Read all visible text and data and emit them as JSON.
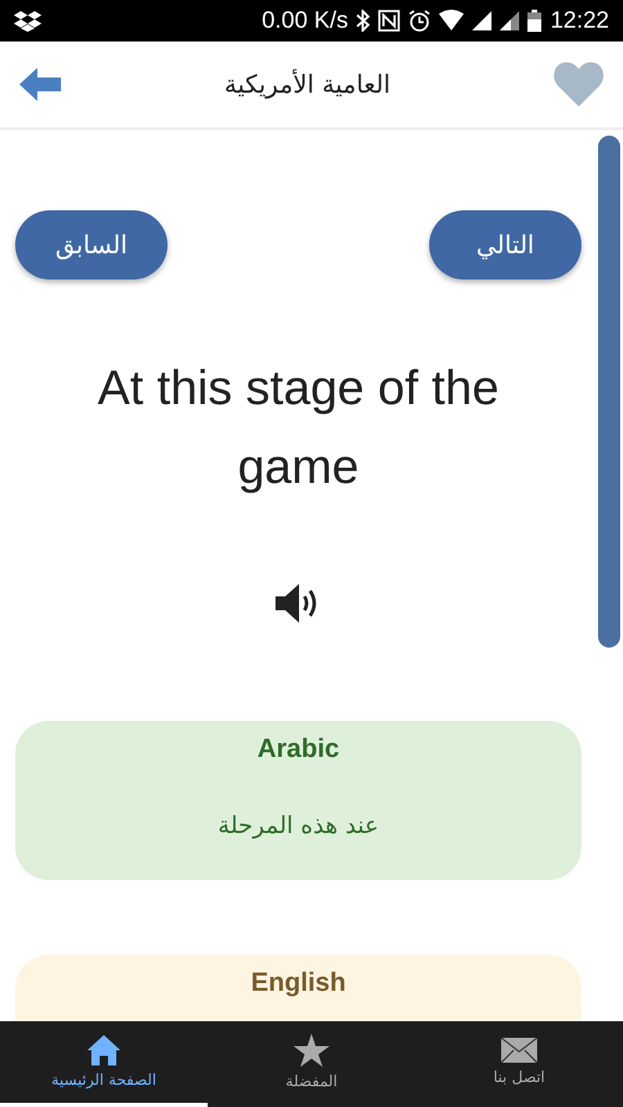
{
  "status_bar": {
    "speed": "0.00 K/s",
    "time": "12:22"
  },
  "header": {
    "title": "العامية الأمريكية",
    "favorite": false
  },
  "nav_buttons": [
    {
      "kind": "next",
      "label": "التالي"
    },
    {
      "kind": "previous",
      "label": "السابق"
    }
  ],
  "phrase": "At this stage of the game",
  "cards": [
    {
      "heading": "Arabic",
      "text": "عند هذه المرحلة",
      "color": "#dff0da"
    },
    {
      "heading": "English",
      "color": "#fdf5e2"
    }
  ],
  "tabs": [
    {
      "kind": "mail",
      "label": "اتصل بنا",
      "selected": false
    },
    {
      "kind": "star",
      "label": "المفضلة",
      "selected": false
    },
    {
      "kind": "home",
      "label": "الصفحة الرئيسية",
      "selected": true
    }
  ]
}
